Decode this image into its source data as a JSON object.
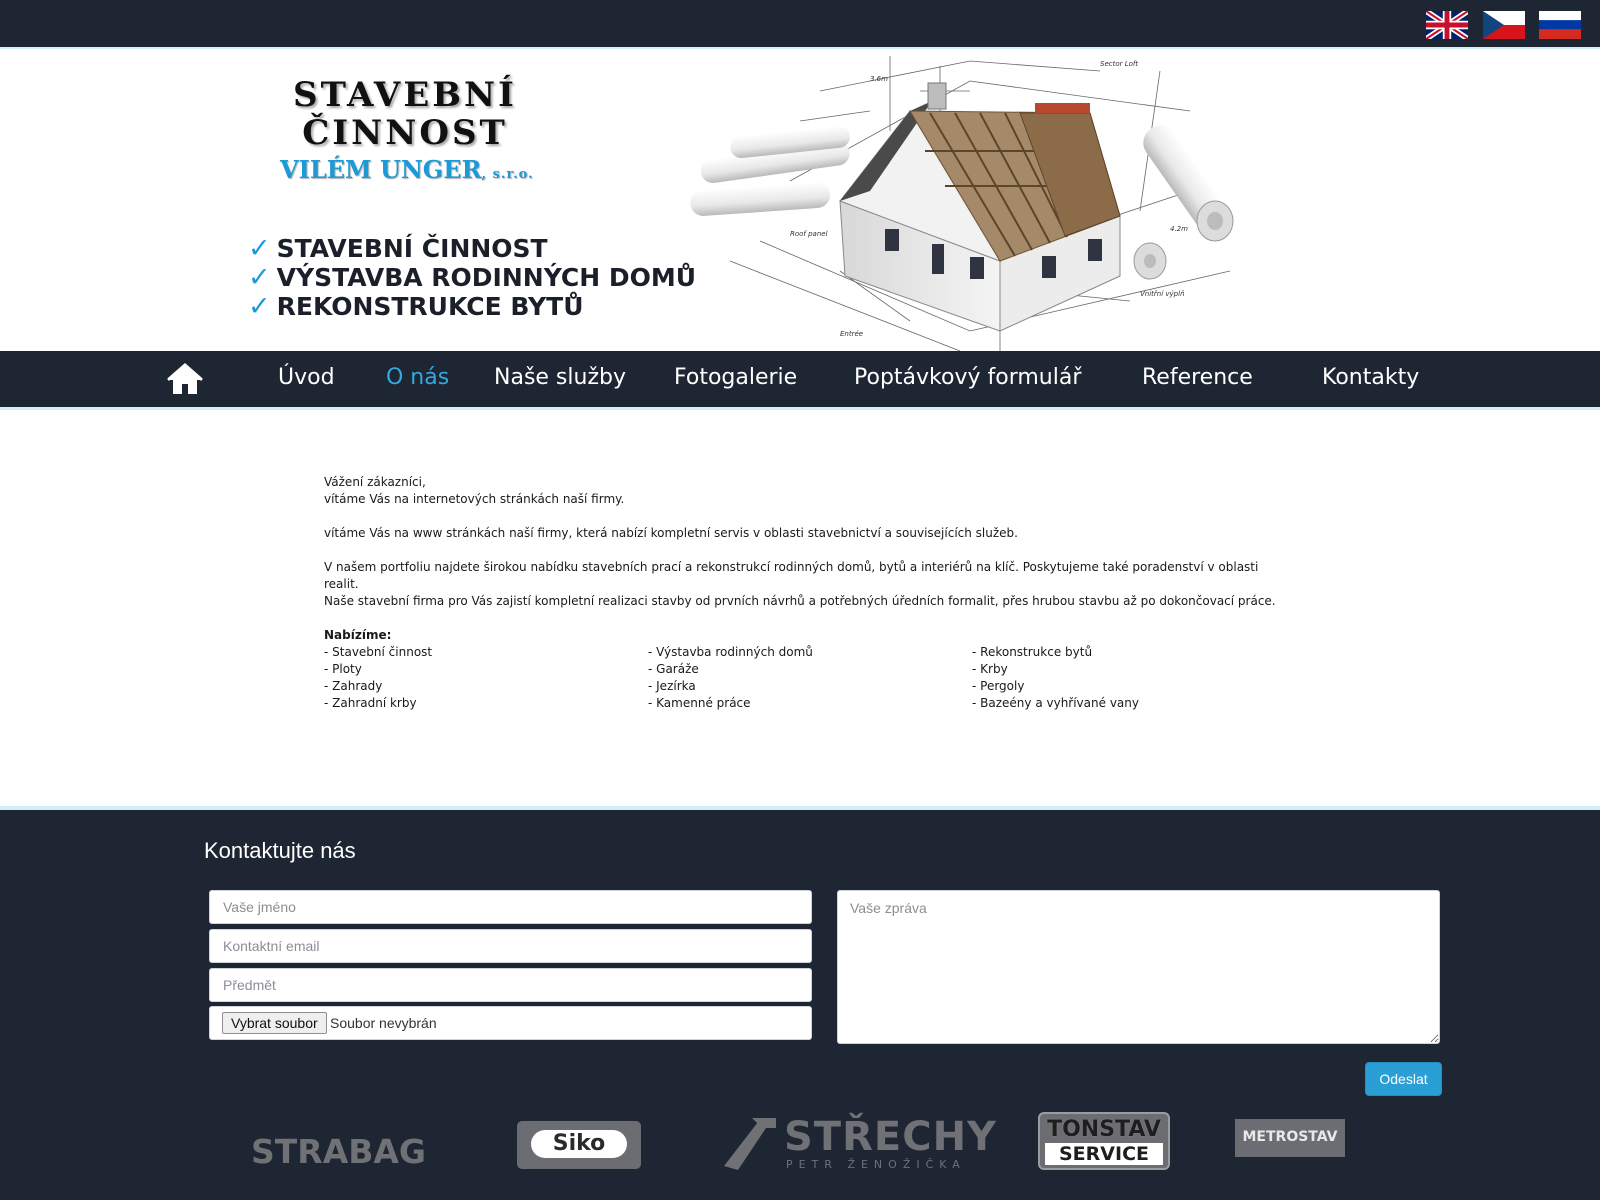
{
  "languages": [
    {
      "code": "en",
      "icon": "uk-flag-icon"
    },
    {
      "code": "cs",
      "icon": "czech-flag-icon"
    },
    {
      "code": "ru",
      "icon": "russian-flag-icon"
    }
  ],
  "header": {
    "logo_line1": "STAVEBNÍ",
    "logo_line2": "ČINNOST",
    "company_name": "VILÉM UNGER",
    "company_suffix": ", s.r.o.",
    "taglines": [
      "STAVEBNÍ ČINNOST",
      "VÝSTAVBA RODINNÝCH DOMŮ",
      "REKONSTRUKCE BYTŮ"
    ],
    "check_glyph": "✓"
  },
  "nav": {
    "home_icon": "home-icon",
    "items": [
      "Úvod",
      "O nás",
      "Naše služby",
      "Fotogalerie",
      "Poptávkový formulář",
      "Reference",
      "Kontakty"
    ],
    "active": "O nás",
    "active_color": "#33a9e0"
  },
  "content": {
    "greeting": "Vážení zákazníci,",
    "welcome": "vítáme Vás na internetových stránkách naší firmy.",
    "intro": "vítáme Vás na www stránkách naší firmy, která nabízí kompletní servis v oblasti stavebnictví a souvisejících služeb.",
    "portfolio1": "V našem portfoliu najdete širokou nabídku stavebních prací a rekonstrukcí rodinných domů, bytů a interiérů na klíč. Poskytujeme také poradenství v oblasti realit.",
    "portfolio2": "Naše stavební firma pro Vás zajistí kompletní realizaci stavby od prvních návrhů a potřebných úředních formalit, přes hrubou stavbu až po dokončovací práce.",
    "offer_title": "Nabízíme:",
    "offers": [
      "- Stavební činnost",
      "- Výstavba rodinných domů",
      "- Rekonstrukce bytů",
      "- Ploty",
      "- Garáže",
      "- Krby",
      "- Zahrady",
      "- Jezírka",
      "- Pergoly",
      "- Zahradní krby",
      "- Kamenné práce",
      "- Bazeény a vyhřívané vany"
    ]
  },
  "contact": {
    "title": "Kontaktujte nás",
    "name_placeholder": "Vaše jméno",
    "email_placeholder": "Kontaktní email",
    "subject_placeholder": "Předmět",
    "file_button": "Vybrat soubor",
    "file_status": "Soubor nevybrán",
    "message_placeholder": "Vaše zpráva",
    "submit_label": "Odeslat",
    "submit_color": "#2a9fd6"
  },
  "partners": {
    "strabag": "STRABAG",
    "siko": "Siko",
    "strechy": "STŘECHY",
    "strechy_sub": "PETR ŽENOŽIČKA",
    "tonstav1": "TONSTAV",
    "tonstav2": "SERVICE",
    "metrostav": "METROSTAV"
  },
  "colors": {
    "dark": "#1e2533",
    "accent": "#1b9ad6"
  }
}
